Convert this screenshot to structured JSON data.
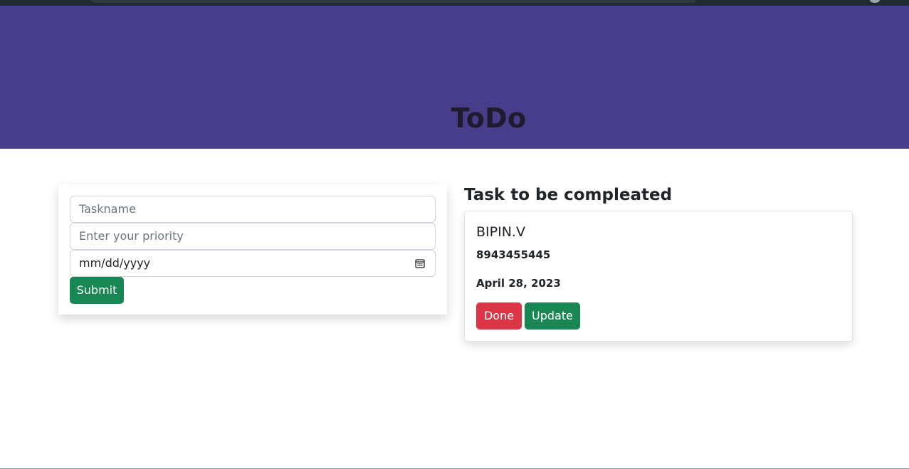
{
  "header": {
    "title": "ToDo",
    "background": "#483d8b"
  },
  "form": {
    "taskname_placeholder": "Taskname",
    "priority_placeholder": "Enter your priority",
    "date_value": "mm/dd/yyyy",
    "submit_label": "Submit"
  },
  "tasks": {
    "heading": "Task to be compleated",
    "items": [
      {
        "name": "BIPIN.V",
        "priority": "8943455445",
        "date": "April 28, 2023",
        "done_label": "Done",
        "update_label": "Update"
      }
    ]
  },
  "colors": {
    "success": "#198754",
    "danger": "#dc3545"
  },
  "icons": {
    "date_picker": "calendar-icon"
  }
}
